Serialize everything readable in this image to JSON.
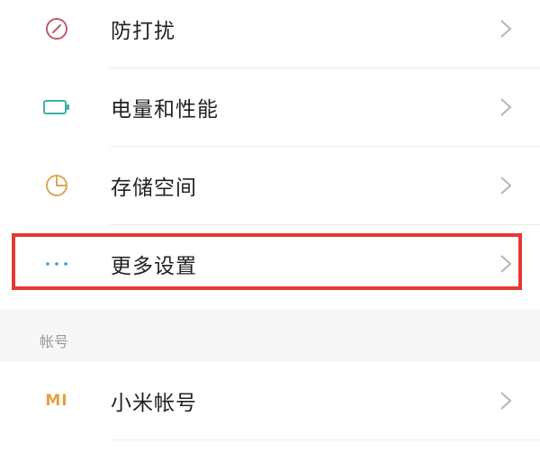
{
  "settings": {
    "rows": [
      {
        "label": "防打扰",
        "icon": "do-not-disturb-icon"
      },
      {
        "label": "电量和性能",
        "icon": "battery-icon"
      },
      {
        "label": "存储空间",
        "icon": "storage-pie-icon"
      },
      {
        "label": "更多设置",
        "icon": "more-dots-icon"
      }
    ],
    "account_section_header": "帐号",
    "account_rows": [
      {
        "label": "小米帐号",
        "icon": "mi-logo-icon",
        "icon_text": "MI"
      }
    ]
  },
  "colors": {
    "highlight_border": "#e53935",
    "dnd_icon": "#c05a6e",
    "battery_icon": "#3bb3a6",
    "storage_icon": "#e0a45c",
    "more_icon": "#3a9ec9",
    "mi_icon": "#e3a13e"
  }
}
